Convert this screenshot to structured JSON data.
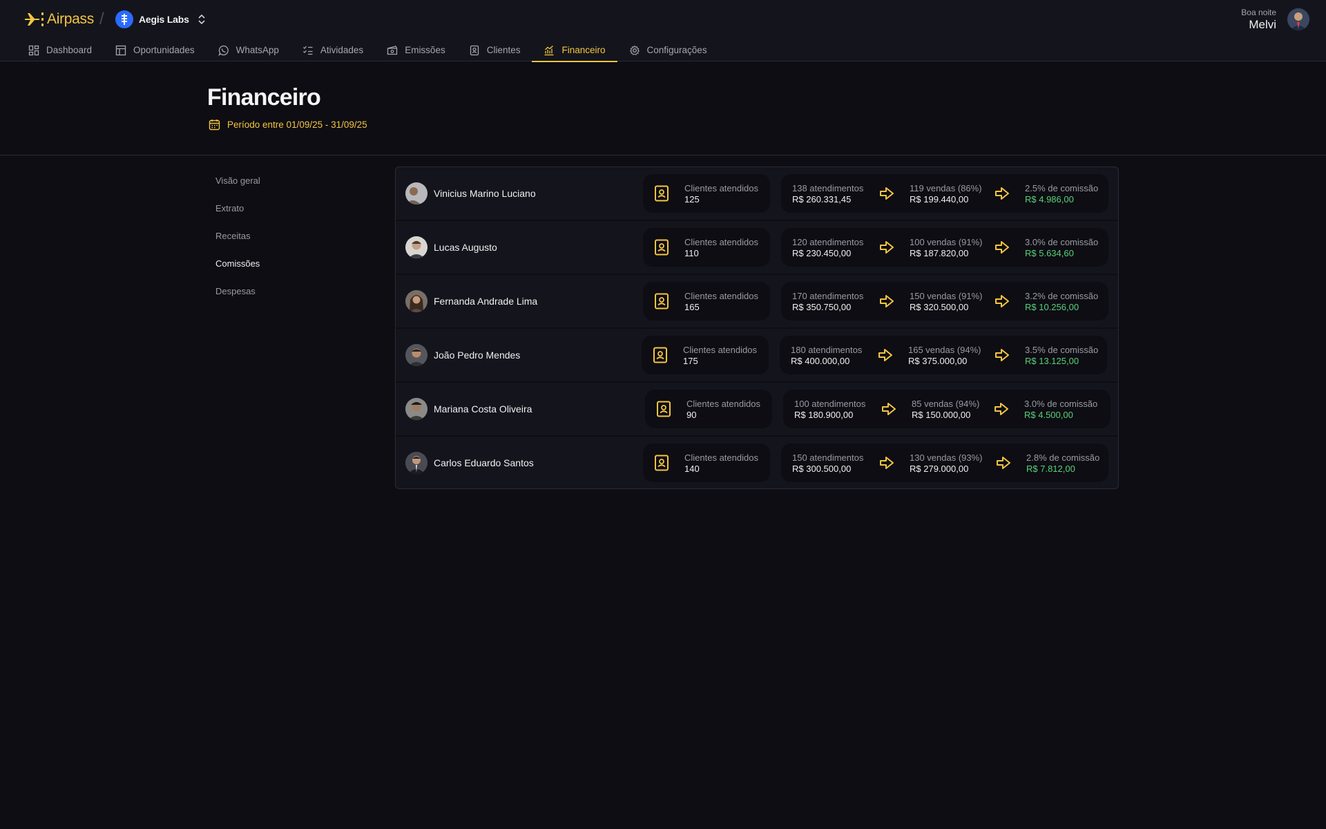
{
  "brand": {
    "name": "Airpass",
    "accent": "#f5c542"
  },
  "org": {
    "name": "Aegis Labs"
  },
  "user": {
    "greeting": "Boa noite",
    "name": "Melvi"
  },
  "nav": [
    {
      "label": "Dashboard",
      "icon": "dashboard-icon"
    },
    {
      "label": "Oportunidades",
      "icon": "table-icon"
    },
    {
      "label": "WhatsApp",
      "icon": "whatsapp-icon"
    },
    {
      "label": "Atividades",
      "icon": "checklist-icon"
    },
    {
      "label": "Emissões",
      "icon": "ticket-icon"
    },
    {
      "label": "Clientes",
      "icon": "contact-book-icon"
    },
    {
      "label": "Financeiro",
      "icon": "chart-icon",
      "active": true
    },
    {
      "label": "Configurações",
      "icon": "gear-icon"
    }
  ],
  "page": {
    "title": "Financeiro",
    "period": "Período entre 01/09/25 - 31/09/25"
  },
  "side_menu": [
    {
      "label": "Visão geral"
    },
    {
      "label": "Extrato"
    },
    {
      "label": "Receitas"
    },
    {
      "label": "Comissões",
      "active": true
    },
    {
      "label": "Despesas"
    }
  ],
  "commissions": [
    {
      "name": "Vinicius Marino Luciano",
      "clients_label": "Clientes atendidos",
      "clients": "125",
      "attendances": "138 atendimentos",
      "attendances_value": "R$ 260.331,45",
      "sales": "119 vendas (86%)",
      "sales_value": "R$ 199.440,00",
      "commission_rate": "2.5% de comissão",
      "commission_value": "R$ 4.986,00"
    },
    {
      "name": "Lucas Augusto",
      "clients_label": "Clientes atendidos",
      "clients": "110",
      "attendances": "120 atendimentos",
      "attendances_value": "R$ 230.450,00",
      "sales": "100 vendas (91%)",
      "sales_value": "R$ 187.820,00",
      "commission_rate": "3.0% de comissão",
      "commission_value": "R$ 5.634,60"
    },
    {
      "name": "Fernanda Andrade Lima",
      "clients_label": "Clientes atendidos",
      "clients": "165",
      "attendances": "170 atendimentos",
      "attendances_value": "R$ 350.750,00",
      "sales": "150 vendas (91%)",
      "sales_value": "R$ 320.500,00",
      "commission_rate": "3.2% de comissão",
      "commission_value": "R$ 10.256,00"
    },
    {
      "name": "João Pedro Mendes",
      "clients_label": "Clientes atendidos",
      "clients": "175",
      "attendances": "180 atendimentos",
      "attendances_value": "R$ 400.000,00",
      "sales": "165 vendas (94%)",
      "sales_value": "R$ 375.000,00",
      "commission_rate": "3.5% de comissão",
      "commission_value": "R$ 13.125,00"
    },
    {
      "name": "Mariana Costa Oliveira",
      "clients_label": "Clientes atendidos",
      "clients": "90",
      "attendances": "100 atendimentos",
      "attendances_value": "R$ 180.900,00",
      "sales": "85 vendas (94%)",
      "sales_value": "R$ 150.000,00",
      "commission_rate": "3.0% de comissão",
      "commission_value": "R$ 4.500,00"
    },
    {
      "name": "Carlos Eduardo Santos",
      "clients_label": "Clientes atendidos",
      "clients": "140",
      "attendances": "150 atendimentos",
      "attendances_value": "R$ 300.500,00",
      "sales": "130 vendas (93%)",
      "sales_value": "R$ 279.000,00",
      "commission_rate": "2.8% de comissão",
      "commission_value": "R$ 7.812,00"
    }
  ]
}
